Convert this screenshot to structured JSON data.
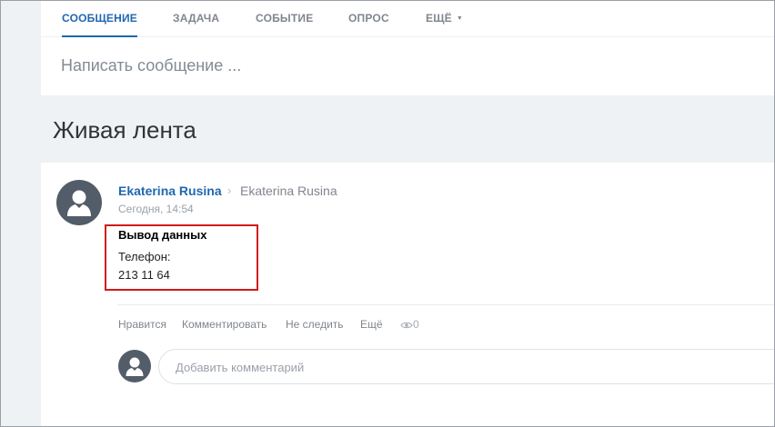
{
  "composer": {
    "tabs": [
      {
        "label": "СООБЩЕНИЕ",
        "active": true
      },
      {
        "label": "ЗАДАЧА",
        "active": false
      },
      {
        "label": "СОБЫТИЕ",
        "active": false
      },
      {
        "label": "ОПРОС",
        "active": false
      },
      {
        "label": "ЕЩЁ",
        "active": false
      }
    ],
    "more_caret_icon": "caret-down-icon",
    "input_placeholder": "Написать сообщение ..."
  },
  "feed": {
    "title": "Живая лента"
  },
  "post": {
    "author": "Ekaterina Rusina",
    "arrow": "›",
    "recipient": "Ekaterina Rusina",
    "time": "Сегодня, 14:54",
    "title": "Вывод данных",
    "body_line1": "Телефон:",
    "body_line2": "213 11 64",
    "actions": {
      "like": "Нравится",
      "comment": "Комментировать",
      "unfollow": "Не следить",
      "more": "Ещё"
    },
    "views_count": "0",
    "comment_placeholder": "Добавить комментарий"
  },
  "colors": {
    "accent": "#1f67b0",
    "highlight_border": "#d11a1a",
    "avatar_bg": "#535c69",
    "page_bg": "#eef2f4"
  }
}
